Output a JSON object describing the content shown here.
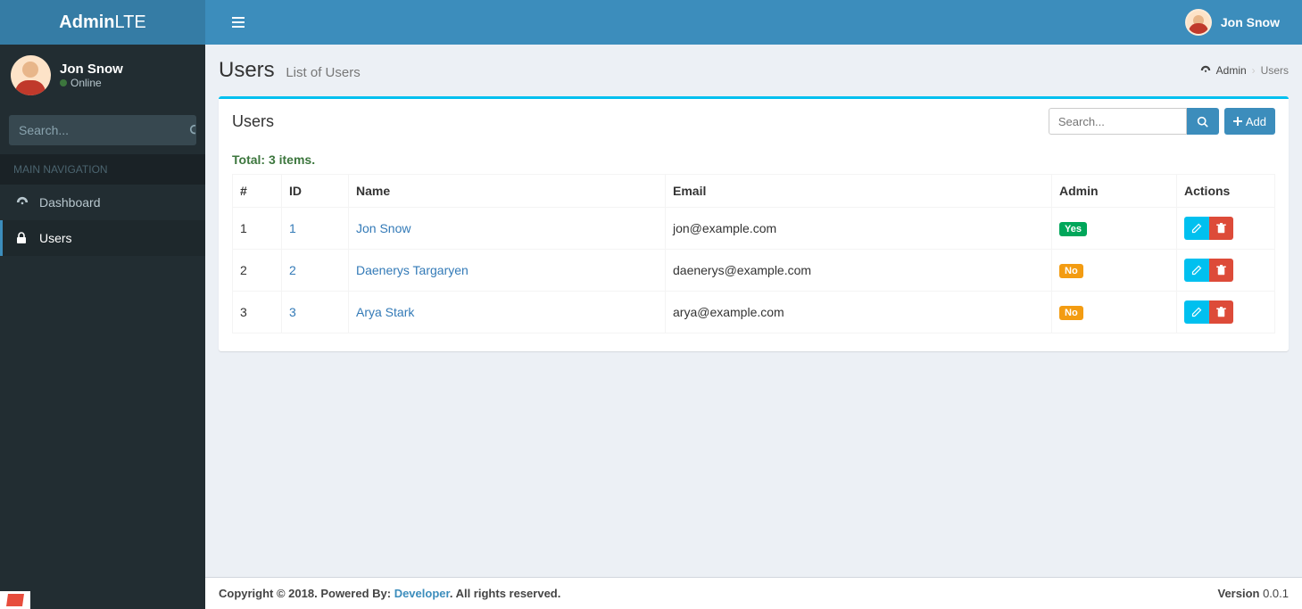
{
  "brand": {
    "bold": "Admin",
    "light": "LTE"
  },
  "header": {
    "user_name": "Jon Snow"
  },
  "sidebar": {
    "user_name": "Jon Snow",
    "status": "Online",
    "search_placeholder": "Search...",
    "section_header": "MAIN NAVIGATION",
    "items": [
      {
        "label": "Dashboard"
      },
      {
        "label": "Users"
      }
    ]
  },
  "page": {
    "title": "Users",
    "subtitle": "List of Users",
    "breadcrumb_root": "Admin",
    "breadcrumb_current": "Users"
  },
  "box": {
    "title": "Users",
    "search_placeholder": "Search...",
    "add_label": "Add"
  },
  "grid": {
    "summary": "Total: 3 items.",
    "headers": {
      "num": "#",
      "id": "ID",
      "name": "Name",
      "email": "Email",
      "admin": "Admin",
      "actions": "Actions"
    },
    "admin_yes": "Yes",
    "admin_no": "No",
    "rows": [
      {
        "num": "1",
        "id": "1",
        "name": "Jon Snow",
        "email": "jon@example.com",
        "admin": true
      },
      {
        "num": "2",
        "id": "2",
        "name": "Daenerys Targaryen",
        "email": "daenerys@example.com",
        "admin": false
      },
      {
        "num": "3",
        "id": "3",
        "name": "Arya Stark",
        "email": "arya@example.com",
        "admin": false
      }
    ]
  },
  "footer": {
    "copyright": "Copyright © 2018. Powered By: ",
    "developer": "Developer",
    "rights": ". All rights reserved.",
    "version_label": "Version",
    "version": " 0.0.1"
  }
}
